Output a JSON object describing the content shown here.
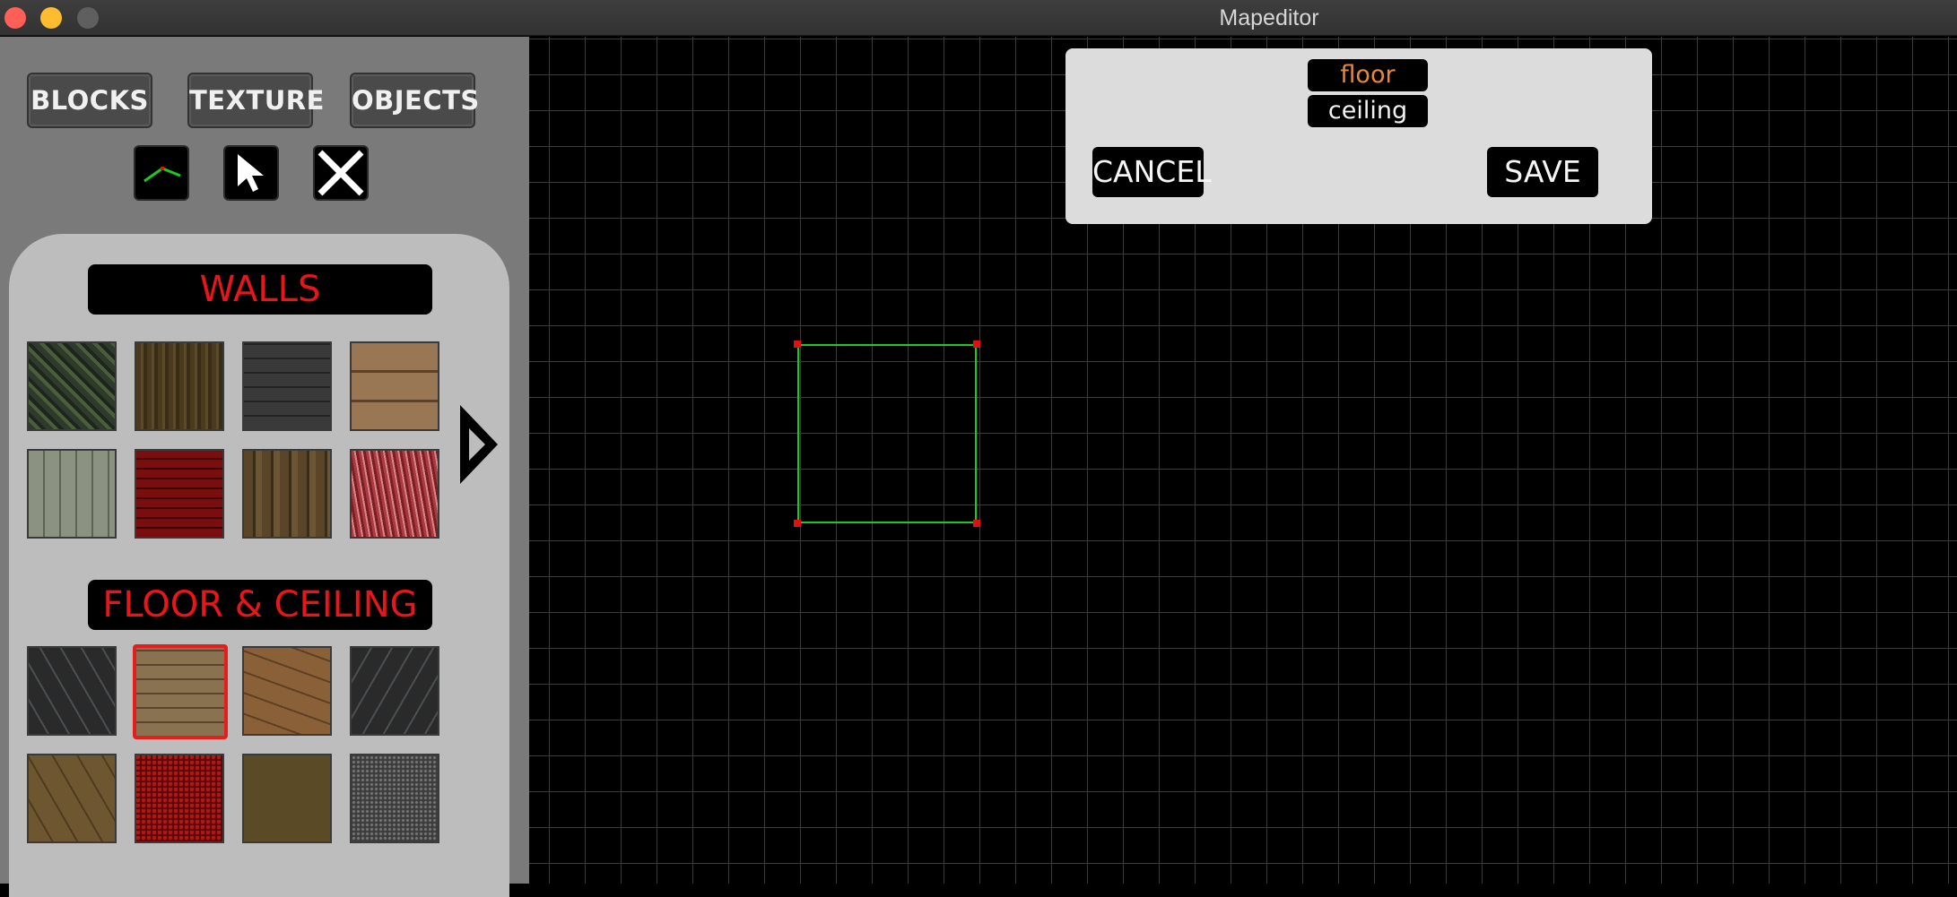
{
  "window": {
    "title": "Mapeditor"
  },
  "tabs": [
    {
      "label": "BLOCKS"
    },
    {
      "label": "TEXTURE"
    },
    {
      "label": "OBJECTS"
    }
  ],
  "tools": [
    {
      "icon": "draw-line-icon"
    },
    {
      "icon": "pointer-icon"
    },
    {
      "icon": "delete-x-icon"
    }
  ],
  "palette": {
    "walls_title": "WALLS",
    "floor_ceiling_title": "FLOOR & CEILING",
    "walls_textures": [
      "mossy-stone",
      "brown-wood-panel",
      "grey-brick",
      "tan-stone-blocks",
      "metal-panel",
      "red-brick",
      "brown-wood-planks",
      "red-flesh"
    ],
    "floor_textures": [
      "dark-hex-tile",
      "tan-brick-floor",
      "cracked-sandstone",
      "dark-hex-tile-2",
      "brown-hex-tile",
      "red-speckle",
      "brown-dirt",
      "grey-gravel"
    ],
    "selected_floor_index": 1
  },
  "dialog": {
    "option_floor": "floor",
    "option_ceiling": "ceiling",
    "cancel_label": "CANCEL",
    "save_label": "SAVE"
  },
  "colors": {
    "header_text": "#e8151b",
    "sector_line": "#1ec81e",
    "vertex": "#e01010",
    "selected_border": "#e51d1d",
    "floor_option_text": "#e8883c"
  }
}
